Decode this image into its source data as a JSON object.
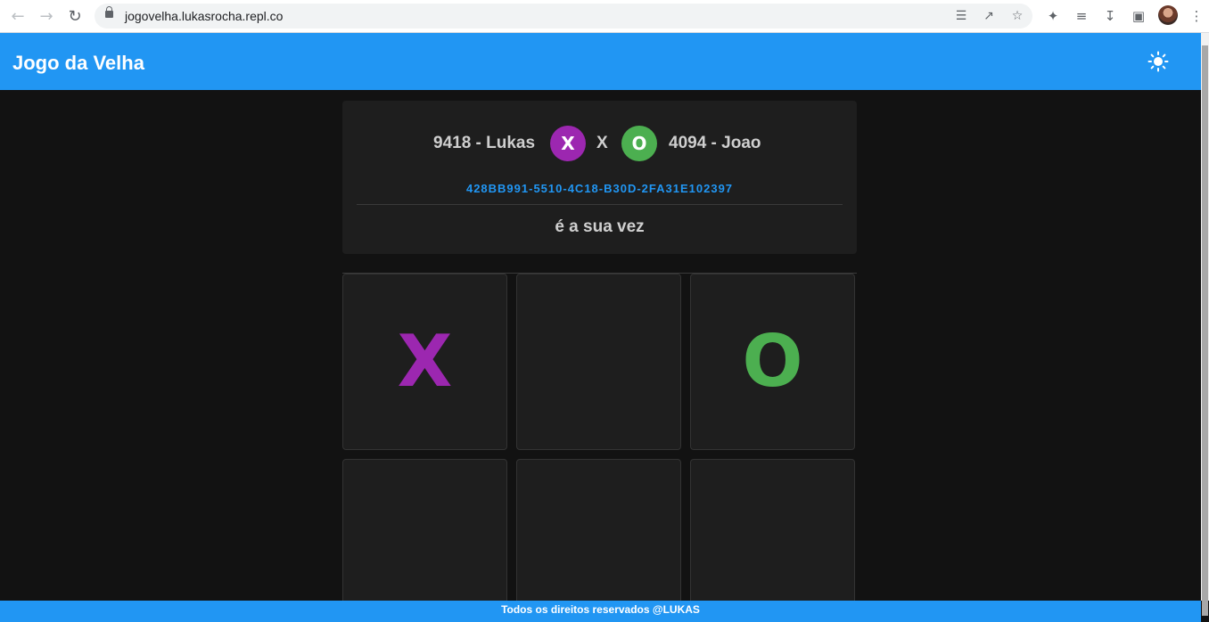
{
  "browser": {
    "url": "jogovelha.lukasrocha.repl.co",
    "back_icon": "arrow-left-icon",
    "forward_icon": "arrow-right-icon",
    "reload_icon": "reload-icon"
  },
  "app": {
    "title": "Jogo da Velha",
    "theme_icon": "sun-icon"
  },
  "match": {
    "player1": {
      "name": "9418 - Lukas",
      "symbol": "X",
      "color": "#9c27b0"
    },
    "separator": "X",
    "player2": {
      "name": "4094 - Joao",
      "symbol": "O",
      "color": "#4caf50"
    },
    "game_id": "428BB991-5510-4C18-B30D-2FA31E102397",
    "turn_text": "é a sua vez"
  },
  "board": {
    "cells": [
      "X",
      "",
      "O",
      "",
      "",
      ""
    ],
    "x_color": "#9c27b0",
    "o_color": "#4caf50"
  },
  "footer": {
    "text": "Todos os direitos reservados @LUKAS"
  }
}
